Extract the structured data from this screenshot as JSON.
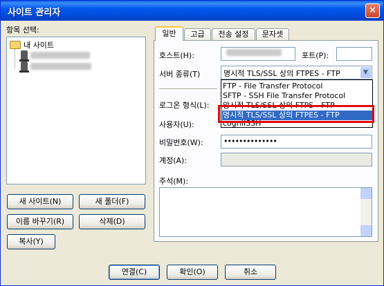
{
  "window": {
    "title": "사이트 관리자",
    "close_glyph": "✕"
  },
  "tree": {
    "label": "항목 선택:",
    "root_label": "내 사이트",
    "sites": [
      {
        "blurred": true
      },
      {
        "blurred": true
      }
    ]
  },
  "left_buttons": {
    "new_site": "새 사이트(N)",
    "new_folder": "새 폴더(F)",
    "rename": "이름 바꾸기(R)",
    "delete": "삭제(D)",
    "copy": "복사(Y)"
  },
  "tabs": [
    "일반",
    "고급",
    "전송 설정",
    "문자셋"
  ],
  "general": {
    "host_label": "호스트(H):",
    "port_label": "포트(P):",
    "port_value": "",
    "server_type_label": "서버 종류(T)",
    "server_type_value": "명시적 TLS/SSL 상의 FTPES - FTP",
    "logon_label": "로그온 형식(L):",
    "user_label": "사용자(U):",
    "password_label": "비밀번호(W):",
    "password_value": "••••••••••••••",
    "account_label": "계정(A):",
    "comments_label": "주석(M):"
  },
  "dropdown_options": [
    "FTP - File Transfer Protocol",
    "SFTP - SSH File Transfer Protocol",
    "암시적 TLS/SSL 상의 FTPS - FTP",
    "명시적 TLS/SSL 상의 FTPES - FTP"
  ],
  "dropdown_selected_index": 3,
  "partial_text": "cognIISSH",
  "bottom_buttons": {
    "connect": "연결(C)",
    "ok": "확인(O)",
    "cancel": "취소"
  },
  "colors": {
    "title_bar": "#0058ee",
    "highlight": "#e10a0a",
    "selection": "#316ac5"
  }
}
